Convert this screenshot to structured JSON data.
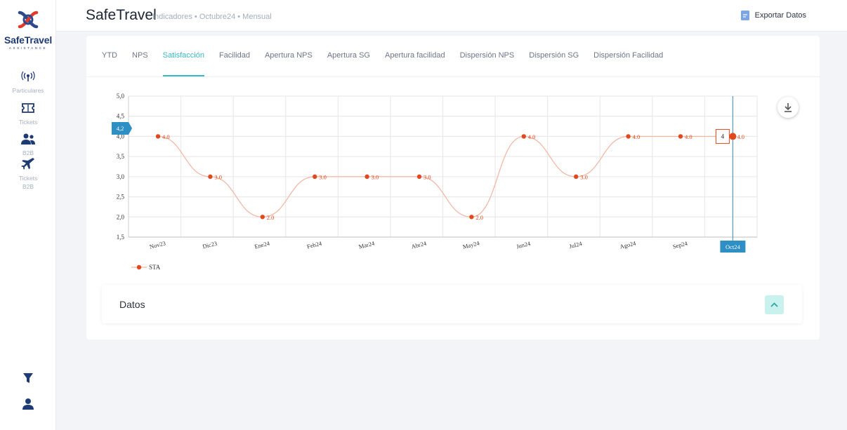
{
  "brand": {
    "name": "SafeTravel",
    "sub": "ASSISTANCE"
  },
  "sidebar": {
    "items": [
      {
        "label": "Particulares",
        "icon": "broadcast-icon"
      },
      {
        "label": "Tickets",
        "icon": "ticket-icon"
      },
      {
        "label": "B2B",
        "icon": "users-icon"
      },
      {
        "label": "Tickets B2B",
        "icon": "plane-icon"
      }
    ],
    "bottom": [
      {
        "icon": "filter-icon"
      },
      {
        "icon": "user-icon"
      }
    ]
  },
  "header": {
    "title": "SafeTravel",
    "breadcrumb": "Indicadores • Octubre24 • Mensual",
    "export_label": "Exportar Datos"
  },
  "tabs": [
    {
      "label": "YTD",
      "active": false
    },
    {
      "label": "NPS",
      "active": false
    },
    {
      "label": "Satisfacción",
      "active": true
    },
    {
      "label": "Facilidad",
      "active": false
    },
    {
      "label": "Apertura NPS",
      "active": false
    },
    {
      "label": "Apertura SG",
      "active": false
    },
    {
      "label": "Apertura facilidad",
      "active": false
    },
    {
      "label": "Dispersión NPS",
      "active": false
    },
    {
      "label": "Dispersión SG",
      "active": false
    },
    {
      "label": "Dispersión Facilidad",
      "active": false
    }
  ],
  "chart_data": {
    "type": "line",
    "categories": [
      "Nov23",
      "Dic23",
      "Ene24",
      "Feb24",
      "Mar24",
      "Abr24",
      "May24",
      "Jun24",
      "Jul24",
      "Ago24",
      "Sep24",
      "Oct24"
    ],
    "series": [
      {
        "name": "STA",
        "values": [
          4,
          3,
          2,
          3,
          3,
          3,
          2,
          4,
          3,
          4,
          4,
          4
        ],
        "color": "#e2481f"
      }
    ],
    "data_labels": [
      "4.0",
      "3.0",
      "2.0",
      "3.0",
      "3.0",
      "3.0",
      "2.0",
      "4.0",
      "3.0",
      "4.0",
      "4.0",
      "4.0"
    ],
    "ylim": [
      1.5,
      5.0
    ],
    "y_ticks": [
      "1,5",
      "2,0",
      "2,5",
      "3,0",
      "3,5",
      "4,0",
      "4,5",
      "5,0"
    ],
    "grid": true,
    "legend": "bottom-left",
    "crosshair": {
      "category": "Oct24",
      "y_label": "4,2",
      "tooltip": "4"
    }
  },
  "datos": {
    "title": "Datos"
  },
  "colors": {
    "accent": "#38b7c4",
    "crosshair": "#2e8fc4",
    "series": "#e2481f"
  }
}
